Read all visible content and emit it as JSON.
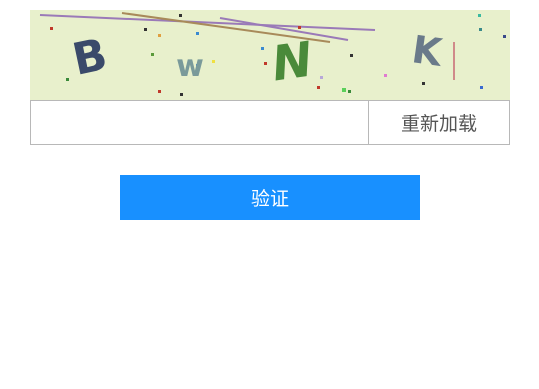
{
  "captcha": {
    "characters": [
      "B",
      "w",
      "N",
      "K"
    ],
    "colors": {
      "background": "#e8f0cc",
      "char_b": "#3a4a6a",
      "char_w": "#7a9a9a",
      "char_n": "#4a8a3a",
      "char_k": "#6a7a8a"
    }
  },
  "form": {
    "input_value": "",
    "input_placeholder": "",
    "reload_label": "重新加载"
  },
  "actions": {
    "verify_label": "验证"
  },
  "colors": {
    "accent": "#1890ff",
    "border": "#b8b8b8"
  }
}
